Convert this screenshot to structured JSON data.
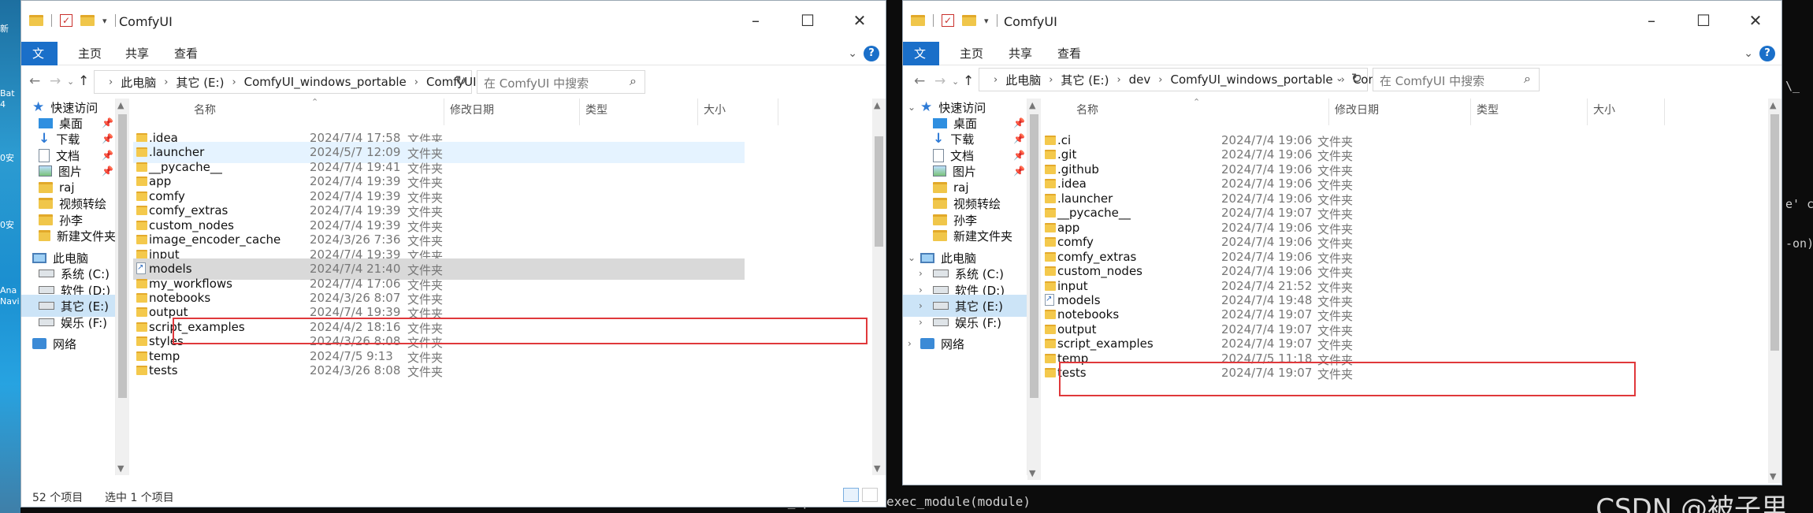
{
  "left_window": {
    "title": "ComfyUI",
    "tabs": [
      "文件",
      "主页",
      "共享",
      "查看"
    ],
    "address": [
      "此电脑",
      "其它 (E:)",
      "ComfyUI_windows_portable",
      "ComfyUI"
    ],
    "search_placeholder": "在 ComfyUI 中搜索",
    "columns": [
      "名称",
      "修改日期",
      "类型",
      "大小"
    ],
    "nav": {
      "quick_access": "快速访问",
      "items": [
        "桌面",
        "下载",
        "文档",
        "图片",
        "raj",
        "视频转绘",
        "孙李",
        "新建文件夹"
      ],
      "this_pc": "此电脑",
      "drives": [
        "系统 (C:)",
        "软件 (D:)",
        "其它 (E:)",
        "娱乐 (F:)"
      ],
      "network": "网络"
    },
    "files": [
      {
        "name": ".idea",
        "date": "2024/7/4 17:58",
        "type": "文件夹"
      },
      {
        "name": ".launcher",
        "date": "2024/5/7 12:09",
        "type": "文件夹"
      },
      {
        "name": "__pycache__",
        "date": "2024/7/4 19:41",
        "type": "文件夹"
      },
      {
        "name": "app",
        "date": "2024/7/4 19:39",
        "type": "文件夹"
      },
      {
        "name": "comfy",
        "date": "2024/7/4 19:39",
        "type": "文件夹"
      },
      {
        "name": "comfy_extras",
        "date": "2024/7/4 19:39",
        "type": "文件夹"
      },
      {
        "name": "custom_nodes",
        "date": "2024/7/4 19:39",
        "type": "文件夹"
      },
      {
        "name": "image_encoder_cache",
        "date": "2024/3/26 7:36",
        "type": "文件夹"
      },
      {
        "name": "input",
        "date": "2024/7/4 19:39",
        "type": "文件夹"
      },
      {
        "name": "models",
        "date": "2024/7/4 21:40",
        "type": "文件夹"
      },
      {
        "name": "my_workflows",
        "date": "2024/7/4 17:06",
        "type": "文件夹"
      },
      {
        "name": "notebooks",
        "date": "2024/3/26 8:07",
        "type": "文件夹"
      },
      {
        "name": "output",
        "date": "2024/7/4 19:39",
        "type": "文件夹"
      },
      {
        "name": "script_examples",
        "date": "2024/4/2 18:16",
        "type": "文件夹"
      },
      {
        "name": "styles",
        "date": "2024/3/26 8:08",
        "type": "文件夹"
      },
      {
        "name": "temp",
        "date": "2024/7/5 9:13",
        "type": "文件夹"
      },
      {
        "name": "tests",
        "date": "2024/3/26 8:08",
        "type": "文件夹"
      }
    ],
    "status_count": "52 个项目",
    "status_selected": "选中 1 个项目"
  },
  "right_window": {
    "title": "ComfyUI",
    "tabs": [
      "文件",
      "主页",
      "共享",
      "查看"
    ],
    "address": [
      "此电脑",
      "其它 (E:)",
      "dev",
      "ComfyUI_windows_portable",
      "ComfyUI"
    ],
    "search_placeholder": "在 ComfyUI 中搜索",
    "columns": [
      "名称",
      "修改日期",
      "类型",
      "大小"
    ],
    "nav": {
      "quick_access": "快速访问",
      "items": [
        "桌面",
        "下载",
        "文档",
        "图片",
        "raj",
        "视频转绘",
        "孙李",
        "新建文件夹"
      ],
      "this_pc": "此电脑",
      "drives": [
        "系统 (C:)",
        "软件 (D:)",
        "其它 (E:)",
        "娱乐 (F:)"
      ],
      "network": "网络"
    },
    "files": [
      {
        "name": ".ci",
        "date": "2024/7/4 19:06",
        "type": "文件夹"
      },
      {
        "name": ".git",
        "date": "2024/7/4 19:06",
        "type": "文件夹"
      },
      {
        "name": ".github",
        "date": "2024/7/4 19:06",
        "type": "文件夹"
      },
      {
        "name": ".idea",
        "date": "2024/7/4 19:06",
        "type": "文件夹"
      },
      {
        "name": ".launcher",
        "date": "2024/7/4 19:06",
        "type": "文件夹"
      },
      {
        "name": "__pycache__",
        "date": "2024/7/4 19:07",
        "type": "文件夹"
      },
      {
        "name": "app",
        "date": "2024/7/4 19:06",
        "type": "文件夹"
      },
      {
        "name": "comfy",
        "date": "2024/7/4 19:06",
        "type": "文件夹"
      },
      {
        "name": "comfy_extras",
        "date": "2024/7/4 19:06",
        "type": "文件夹"
      },
      {
        "name": "custom_nodes",
        "date": "2024/7/4 19:06",
        "type": "文件夹"
      },
      {
        "name": "input",
        "date": "2024/7/4 21:52",
        "type": "文件夹"
      },
      {
        "name": "models",
        "date": "2024/7/4 19:48",
        "type": "文件夹"
      },
      {
        "name": "notebooks",
        "date": "2024/7/4 19:07",
        "type": "文件夹"
      },
      {
        "name": "output",
        "date": "2024/7/4 19:07",
        "type": "文件夹"
      },
      {
        "name": "script_examples",
        "date": "2024/7/4 19:07",
        "type": "文件夹"
      },
      {
        "name": "temp",
        "date": "2024/7/5 11:18",
        "type": "文件夹"
      },
      {
        "name": "tests",
        "date": "2024/7/4 19:07",
        "type": "文件夹"
      }
    ]
  },
  "desktop": {
    "left_labels": [
      "新",
      "Bat",
      "4",
      "0安",
      "0安",
      "Ana",
      "Navi"
    ],
    "terminal_bottom": "module_spec.loader.exec_module(module)",
    "terminal_right": [
      "e' c",
      "-on)",
      "\\_"
    ],
    "watermark": "CSDN @被子里"
  }
}
